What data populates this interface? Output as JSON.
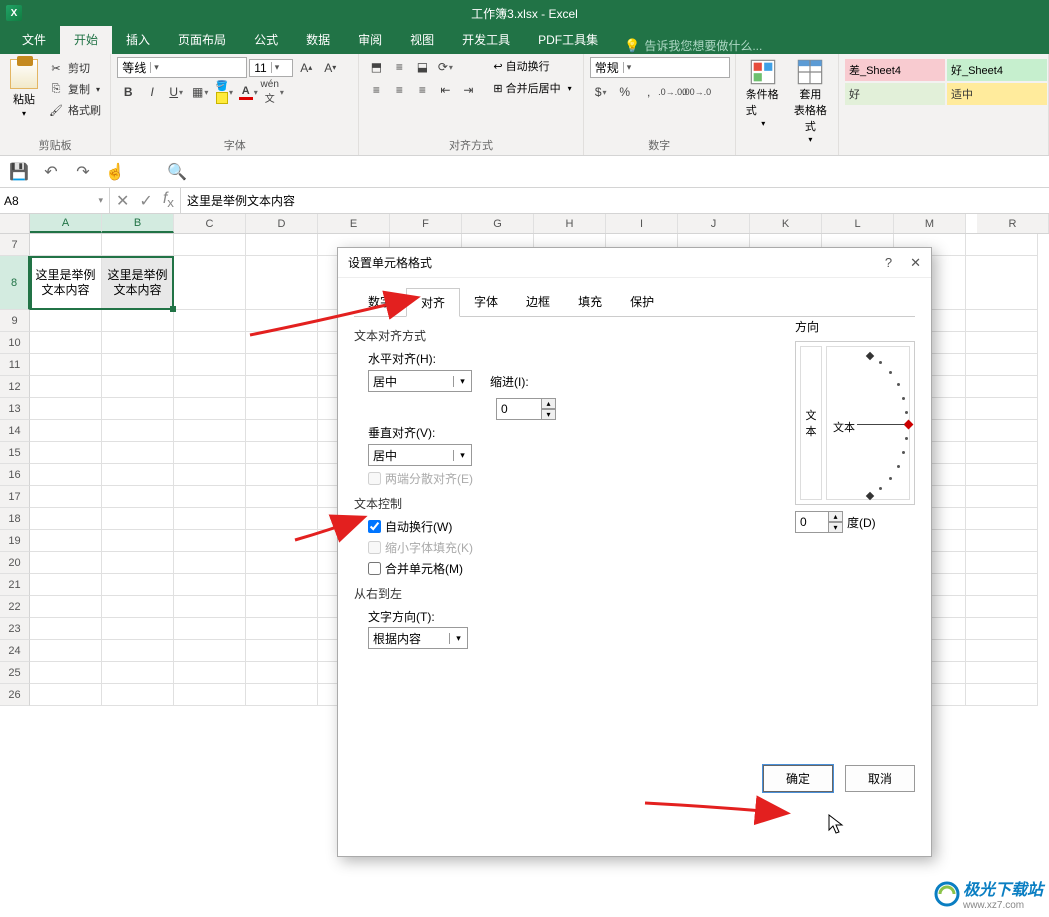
{
  "title": "工作簿3.xlsx - Excel",
  "tabs": {
    "file": "文件",
    "home": "开始",
    "insert": "插入",
    "layout": "页面布局",
    "formulas": "公式",
    "data": "数据",
    "review": "审阅",
    "view": "视图",
    "dev": "开发工具",
    "pdf": "PDF工具集",
    "tellme": "告诉我您想要做什么..."
  },
  "ribbon": {
    "paste": "粘贴",
    "cut": "剪切",
    "copy": "复制",
    "format_painter": "格式刷",
    "clipboard_group": "剪贴板",
    "font_name": "等线",
    "font_size": "11",
    "font_group": "字体",
    "wrap_text": "自动换行",
    "merge_center": "合并后居中",
    "align_group": "对齐方式",
    "num_format": "常规",
    "num_group": "数字",
    "cond_fmt": "条件格式",
    "as_table": "套用\n表格格式",
    "style_bad": "差_Sheet4",
    "style_good": "好_Sheet4",
    "style_ok": "好",
    "style_neutral": "适中"
  },
  "name_box": "A8",
  "formula": "这里是举例文本内容",
  "columns": [
    "A",
    "B",
    "C",
    "D",
    "E",
    "F",
    "G",
    "H",
    "I",
    "J",
    "K",
    "L",
    "M",
    "R"
  ],
  "row_headers": [
    7,
    8,
    9,
    10,
    11,
    12,
    13,
    14,
    15,
    16,
    17,
    18,
    19,
    20,
    21,
    22,
    23,
    24,
    25,
    26
  ],
  "cell_a8": "这里是举例文本内容",
  "cell_b8": "这里是举例文本内容",
  "dialog": {
    "title": "设置单元格格式",
    "tabs": {
      "number": "数字",
      "align": "对齐",
      "font": "字体",
      "border": "边框",
      "fill": "填充",
      "protect": "保护"
    },
    "section_textalign": "文本对齐方式",
    "h_align_label": "水平对齐(H):",
    "h_align_value": "居中",
    "indent_label": "缩进(I):",
    "indent_value": "0",
    "v_align_label": "垂直对齐(V):",
    "v_align_value": "居中",
    "justify_dist": "两端分散对齐(E)",
    "section_textctrl": "文本控制",
    "wrap": "自动换行(W)",
    "shrink": "缩小字体填充(K)",
    "merge": "合并单元格(M)",
    "section_rtl": "从右到左",
    "textdir_label": "文字方向(T):",
    "textdir_value": "根据内容",
    "orient_label": "方向",
    "orient_vt": "文本",
    "orient_horiz": "文本",
    "deg_value": "0",
    "deg_label": "度(D)",
    "ok": "确定",
    "cancel": "取消"
  },
  "watermark": "极光下载站",
  "watermark_sub": "www.xz7.com"
}
